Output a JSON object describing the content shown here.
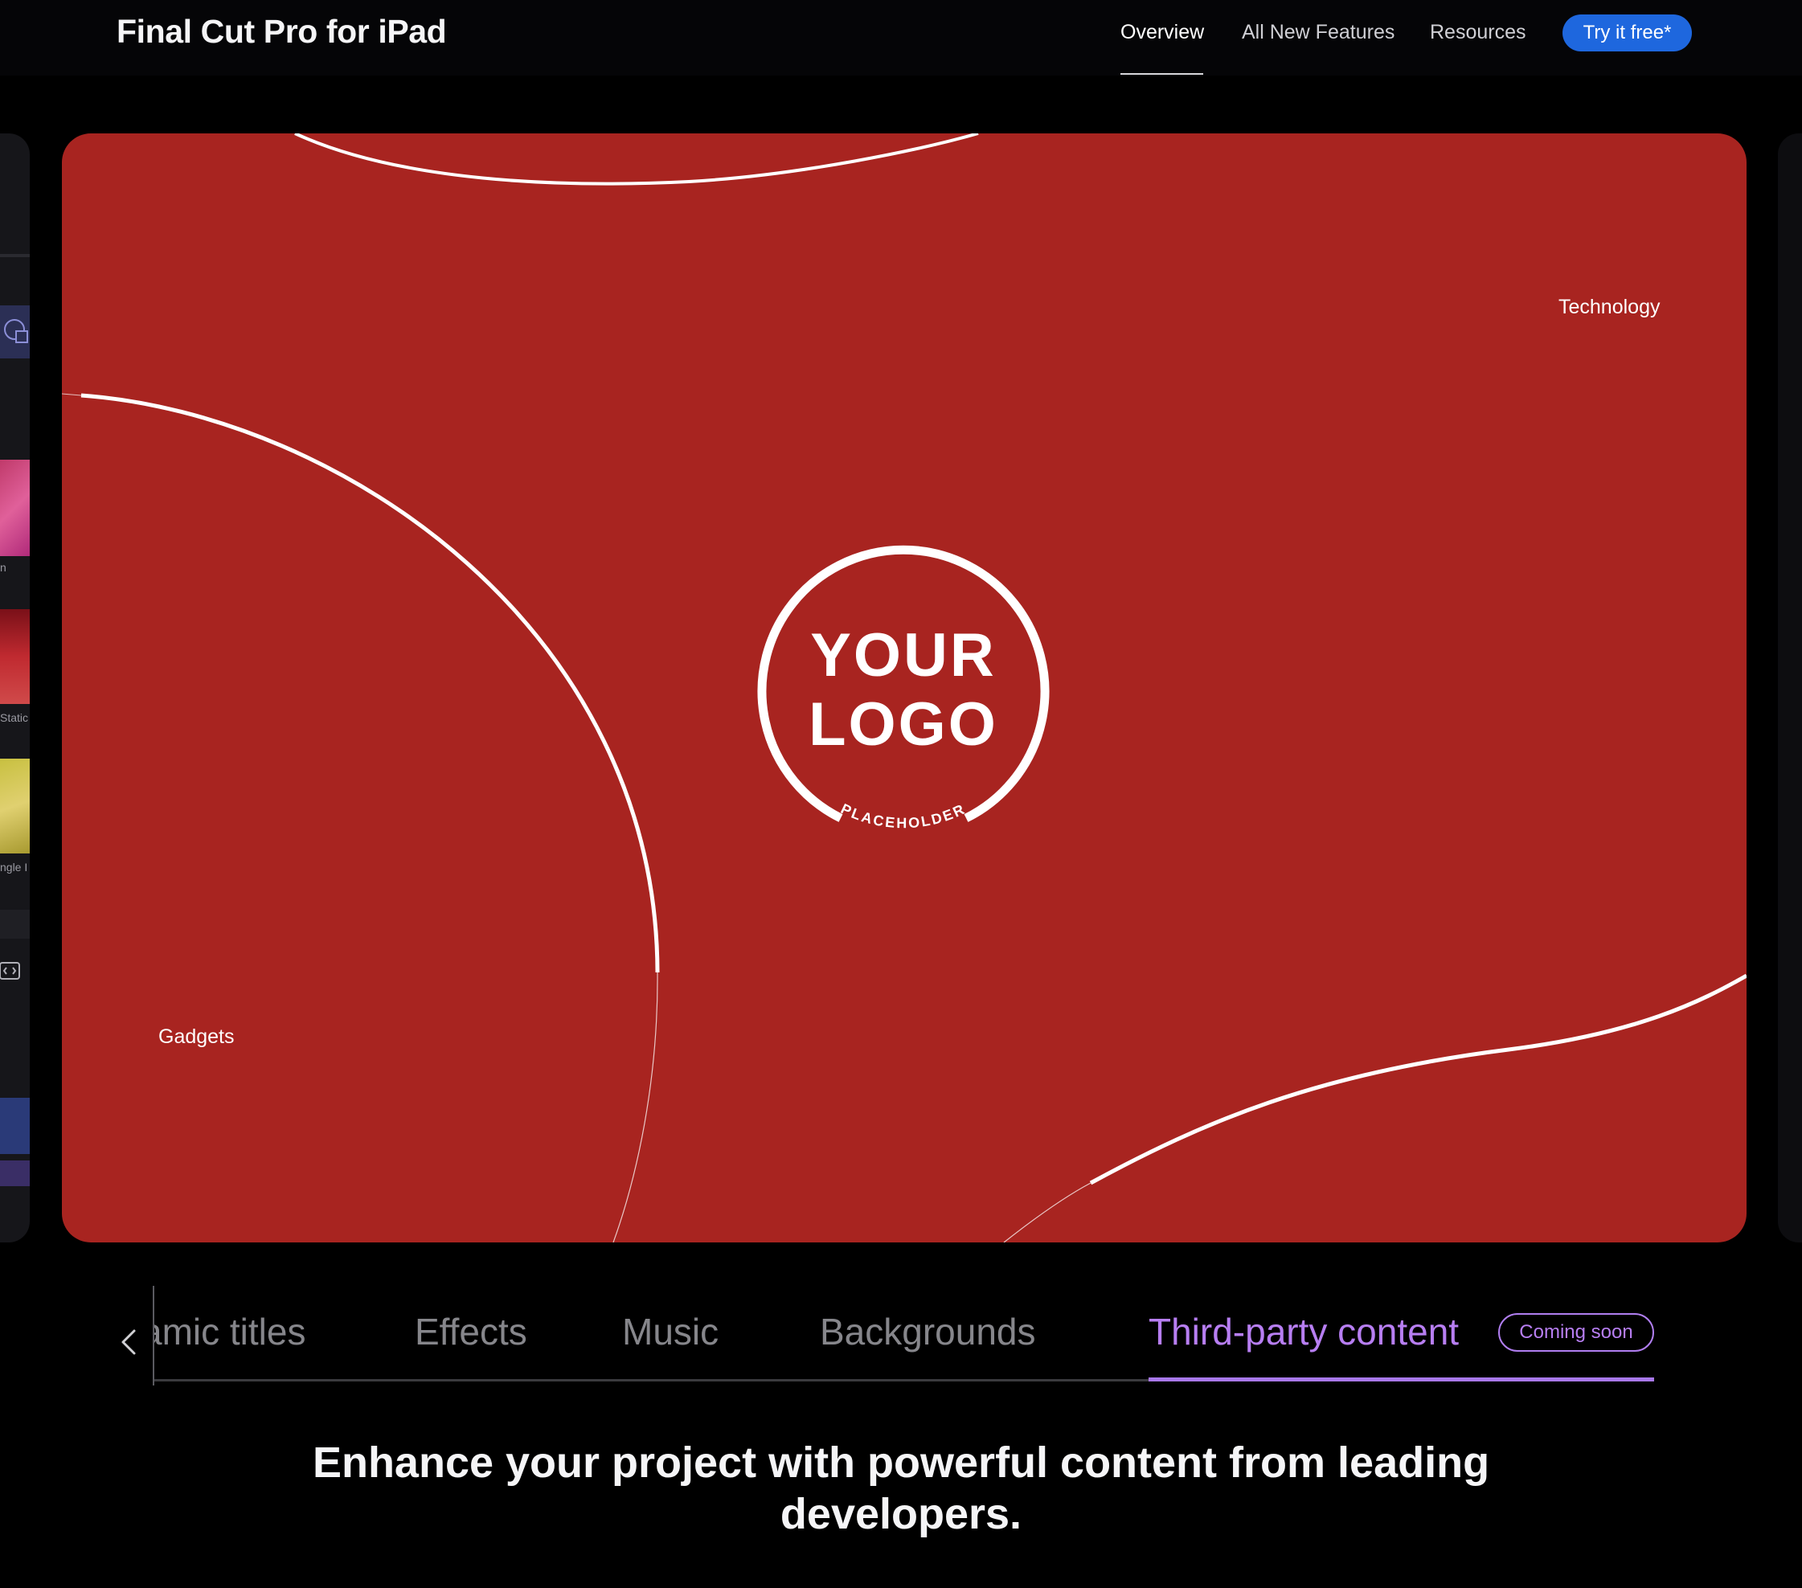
{
  "nav": {
    "brand": "Final Cut Pro for iPad",
    "links": [
      {
        "label": "Overview",
        "active": true
      },
      {
        "label": "All New Features",
        "active": false
      },
      {
        "label": "Resources",
        "active": false
      }
    ],
    "cta_label": "Try it free*"
  },
  "side_panel_left": {
    "labels": [
      "n",
      "Static",
      "ngle I"
    ]
  },
  "stage": {
    "background_color": "#a82420",
    "label_top_right": "Technology",
    "label_bottom_left": "Gadgets",
    "logo": {
      "line1": "YOUR",
      "line2": "LOGO",
      "arc_text": "PLACEHOLDER"
    }
  },
  "tabs": {
    "items": [
      {
        "label": "amic titles",
        "active": false
      },
      {
        "label": "Effects",
        "active": false
      },
      {
        "label": "Music",
        "active": false
      },
      {
        "label": "Backgrounds",
        "active": false
      },
      {
        "label": "Third-party content",
        "active": true
      }
    ],
    "badge": "Coming soon",
    "accent_color": "#b77ef2"
  },
  "headline": "Enhance your project with powerful content from leading developers."
}
